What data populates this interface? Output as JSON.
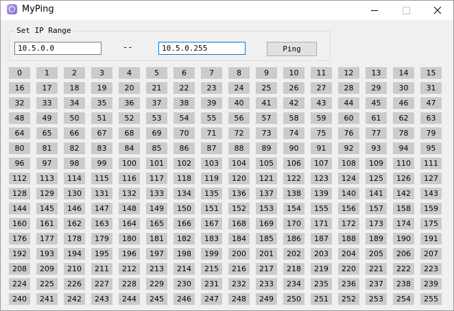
{
  "window": {
    "title": "MyPing",
    "icon": "app-icon",
    "controls": [
      "minimize-icon",
      "maximize-icon",
      "close-icon"
    ]
  },
  "range": {
    "group_label": "Set IP Range",
    "start_ip": "10.5.0.0",
    "separator": "--",
    "end_ip": "10.5.0.255",
    "ping_label": "Ping"
  },
  "hosts": {
    "values": [
      "0",
      "1",
      "2",
      "3",
      "4",
      "5",
      "6",
      "7",
      "8",
      "9",
      "10",
      "11",
      "12",
      "13",
      "14",
      "15",
      "16",
      "17",
      "18",
      "19",
      "20",
      "21",
      "22",
      "23",
      "24",
      "25",
      "26",
      "27",
      "28",
      "29",
      "30",
      "31",
      "32",
      "33",
      "34",
      "35",
      "36",
      "37",
      "38",
      "39",
      "40",
      "41",
      "42",
      "43",
      "44",
      "45",
      "46",
      "47",
      "48",
      "49",
      "50",
      "51",
      "52",
      "53",
      "54",
      "55",
      "56",
      "57",
      "58",
      "59",
      "60",
      "61",
      "62",
      "63",
      "64",
      "65",
      "66",
      "67",
      "68",
      "69",
      "70",
      "71",
      "72",
      "73",
      "74",
      "75",
      "76",
      "77",
      "78",
      "79",
      "80",
      "81",
      "82",
      "83",
      "84",
      "85",
      "86",
      "87",
      "88",
      "89",
      "90",
      "91",
      "92",
      "93",
      "94",
      "95",
      "96",
      "97",
      "98",
      "99",
      "100",
      "101",
      "102",
      "103",
      "104",
      "105",
      "106",
      "107",
      "108",
      "109",
      "110",
      "111",
      "112",
      "113",
      "114",
      "115",
      "116",
      "117",
      "118",
      "119",
      "120",
      "121",
      "122",
      "123",
      "124",
      "125",
      "126",
      "127",
      "128",
      "129",
      "130",
      "131",
      "132",
      "133",
      "134",
      "135",
      "136",
      "137",
      "138",
      "139",
      "140",
      "141",
      "142",
      "143",
      "144",
      "145",
      "146",
      "147",
      "148",
      "149",
      "150",
      "151",
      "152",
      "153",
      "154",
      "155",
      "156",
      "157",
      "158",
      "159",
      "160",
      "161",
      "162",
      "163",
      "164",
      "165",
      "166",
      "167",
      "168",
      "169",
      "170",
      "171",
      "172",
      "173",
      "174",
      "175",
      "176",
      "177",
      "178",
      "179",
      "180",
      "181",
      "182",
      "183",
      "184",
      "185",
      "186",
      "187",
      "188",
      "189",
      "190",
      "191",
      "192",
      "193",
      "194",
      "195",
      "196",
      "197",
      "198",
      "199",
      "200",
      "201",
      "202",
      "203",
      "204",
      "205",
      "206",
      "207",
      "208",
      "209",
      "210",
      "211",
      "212",
      "213",
      "214",
      "215",
      "216",
      "217",
      "218",
      "219",
      "220",
      "221",
      "222",
      "223",
      "224",
      "225",
      "226",
      "227",
      "228",
      "229",
      "230",
      "231",
      "232",
      "233",
      "234",
      "235",
      "236",
      "237",
      "238",
      "239",
      "240",
      "241",
      "242",
      "243",
      "244",
      "245",
      "246",
      "247",
      "248",
      "249",
      "250",
      "251",
      "252",
      "253",
      "254",
      "255"
    ],
    "cell_color": "#cbcbcb"
  }
}
